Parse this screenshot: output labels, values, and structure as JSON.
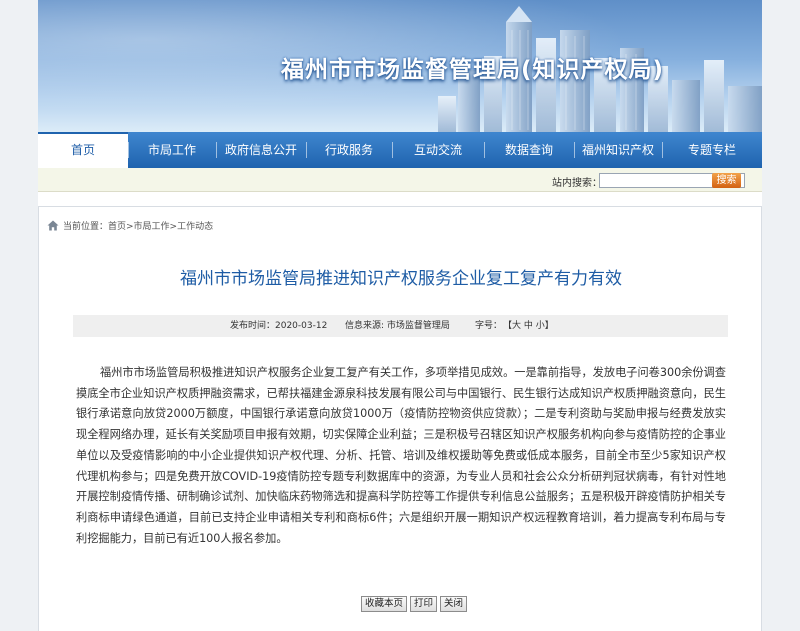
{
  "header": {
    "title": "福州市市场监督管理局(知识产权局)"
  },
  "nav": {
    "items": [
      {
        "label": "首页",
        "active": true
      },
      {
        "label": "市局工作"
      },
      {
        "label": "政府信息公开"
      },
      {
        "label": "行政服务"
      },
      {
        "label": "互动交流"
      },
      {
        "label": "数据查询"
      },
      {
        "label": "福州知识产权"
      },
      {
        "label": "专题专栏"
      }
    ]
  },
  "search": {
    "label": "站内搜索：",
    "value": "",
    "placeholder": "",
    "button_label": "搜索"
  },
  "breadcrumb": {
    "text": "当前位置：首页>市局工作>工作动态"
  },
  "article": {
    "title": "福州市市场监管局推进知识产权服务企业复工复产有力有效",
    "publish_time": "发布时间：2020-03-12",
    "source": "信息来源: 市场监督管理局",
    "font_size_label": "字号：",
    "font_size_options": "【大 中 小】",
    "body": "福州市市场监管局积极推进知识产权服务企业复工复产有关工作，多项举措见成效。一是靠前指导，发放电子问卷300余份调查摸底全市企业知识产权质押融资需求，已帮扶福建金源泉科技发展有限公司与中国银行、民生银行达成知识产权质押融资意向，民生银行承诺意向放贷2000万额度，中国银行承诺意向放贷1000万（疫情防控物资供应贷款）；二是专利资助与奖励申报与经费发放实现全程网络办理，延长有关奖励项目申报有效期，切实保障企业利益；三是积极号召辖区知识产权服务机构向参与疫情防控的企事业单位以及受疫情影响的中小企业提供知识产权代理、分析、托管、培训及维权援助等免费或低成本服务，目前全市至少5家知识产权代理机构参与；四是免费开放COVID-19疫情防控专题专利数据库中的资源，为专业人员和社会公众分析研判冠状病毒，有针对性地开展控制疫情传播、研制确诊试剂、加快临床药物筛选和提高科学防控等工作提供专利信息公益服务；五是积极开辟疫情防护相关专利商标申请绿色通道，目前已支持企业申请相关专利和商标6件；六是组织开展一期知识产权远程教育培训，着力提高专利布局与专利挖掘能力，目前已有近100人报名参加。"
  },
  "actions": {
    "favorite": "收藏本页",
    "print": "打印",
    "close": "关闭"
  },
  "colors": {
    "nav_bg": "#1f63ae",
    "title_blue": "#1e5ca5",
    "search_button": "#e07a22"
  }
}
